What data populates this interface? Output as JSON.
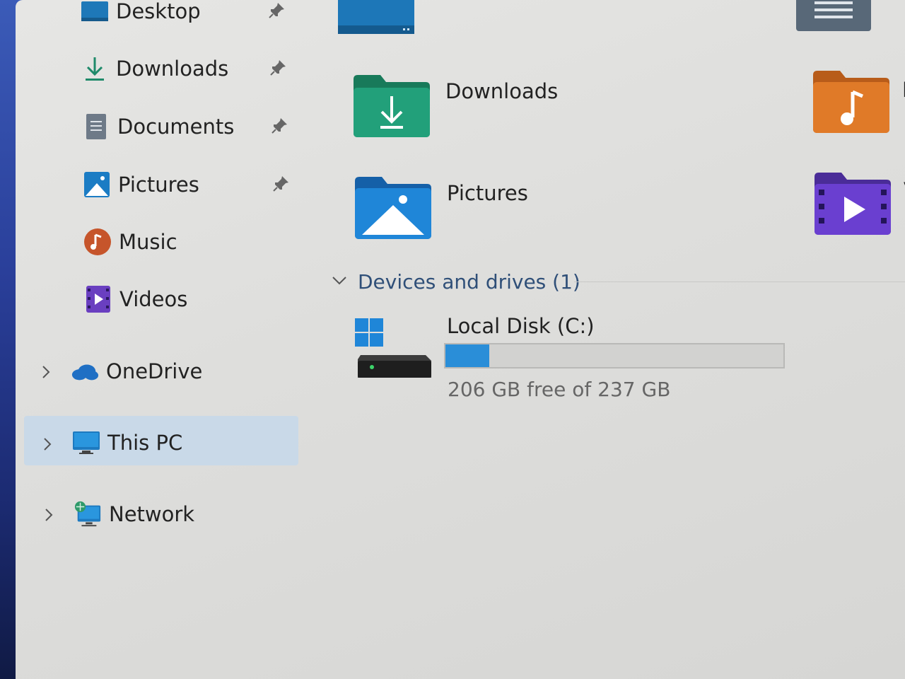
{
  "sidebar": {
    "quick_access": [
      {
        "label": "Desktop",
        "icon": "desktop-icon",
        "pinned": true
      },
      {
        "label": "Downloads",
        "icon": "download-arrow-icon",
        "pinned": true
      },
      {
        "label": "Documents",
        "icon": "documents-icon",
        "pinned": true
      },
      {
        "label": "Pictures",
        "icon": "pictures-icon",
        "pinned": true
      },
      {
        "label": "Music",
        "icon": "music-icon",
        "pinned": false
      },
      {
        "label": "Videos",
        "icon": "videos-icon",
        "pinned": false
      }
    ],
    "locations": [
      {
        "label": "OneDrive",
        "icon": "cloud-icon",
        "expand": "chevron-right-icon",
        "selected": false
      },
      {
        "label": "This PC",
        "icon": "computer-icon",
        "expand": "chevron-right-icon",
        "selected": true
      },
      {
        "label": "Network",
        "icon": "network-icon",
        "expand": "chevron-right-icon",
        "selected": false
      }
    ]
  },
  "main": {
    "folders": [
      {
        "label": "Downloads",
        "icon": "downloads-folder-icon"
      },
      {
        "label": "Pictures",
        "icon": "pictures-folder-icon"
      },
      {
        "label": "M",
        "icon": "music-folder-icon"
      },
      {
        "label": "Vi",
        "icon": "videos-folder-icon"
      }
    ],
    "devices_section": {
      "title": "Devices and drives (1)",
      "icon": "chevron-down-icon"
    },
    "drive": {
      "name": "Local Disk (C:)",
      "free_text": "206 GB free of 237 GB",
      "used_fraction": 0.13,
      "icon": "local-disk-icon"
    }
  },
  "colors": {
    "selection": "#c9d9e8",
    "accent": "#2a8ed8",
    "section_text": "#2f4f78"
  }
}
